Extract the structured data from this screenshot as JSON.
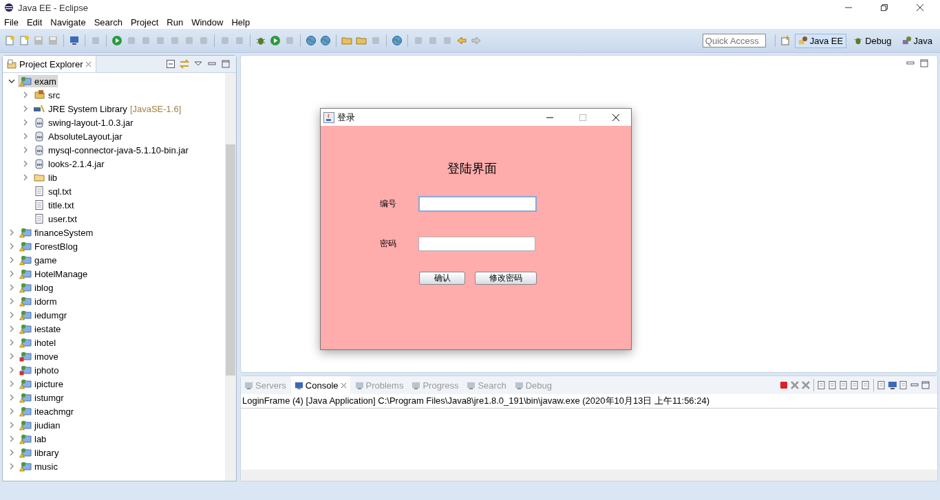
{
  "window": {
    "title": "Java EE - Eclipse"
  },
  "menu": [
    "File",
    "Edit",
    "Navigate",
    "Search",
    "Project",
    "Run",
    "Window",
    "Help"
  ],
  "toolbar": {
    "quick_access": {
      "placeholder": "Quick Access"
    },
    "perspectives": [
      {
        "label": "Java EE",
        "selected": true,
        "kind": "jee"
      },
      {
        "label": "Debug",
        "selected": false,
        "kind": "debug"
      },
      {
        "label": "Java",
        "selected": false,
        "kind": "java"
      }
    ]
  },
  "project_explorer": {
    "title": "Project Explorer",
    "tree": [
      {
        "label": "exam",
        "kind": "project",
        "error": false,
        "expanded": true,
        "selected": true,
        "children": [
          {
            "label": "src",
            "kind": "src",
            "expanded": false,
            "selected": false
          },
          {
            "label": "JRE System Library",
            "note": "[JavaSE-1.6]",
            "kind": "library",
            "expanded": false,
            "selected": false
          },
          {
            "label": "swing-layout-1.0.3.jar",
            "kind": "jar",
            "expanded": false,
            "selected": false
          },
          {
            "label": "AbsoluteLayout.jar",
            "kind": "jar",
            "expanded": false,
            "selected": false
          },
          {
            "label": "mysql-connector-java-5.1.10-bin.jar",
            "kind": "jar",
            "expanded": false,
            "selected": false
          },
          {
            "label": "looks-2.1.4.jar",
            "kind": "jar",
            "expanded": false,
            "selected": false
          },
          {
            "label": "lib",
            "kind": "folder",
            "expanded": false,
            "selected": false
          },
          {
            "label": "sql.txt",
            "kind": "file",
            "selected": false
          },
          {
            "label": "title.txt",
            "kind": "file",
            "selected": false
          },
          {
            "label": "user.txt",
            "kind": "file",
            "selected": false
          }
        ]
      },
      {
        "label": "financeSystem",
        "kind": "project",
        "error": false,
        "expanded": false,
        "selected": false
      },
      {
        "label": "ForestBlog",
        "kind": "project",
        "error": false,
        "expanded": false,
        "selected": false
      },
      {
        "label": "game",
        "kind": "project",
        "error": false,
        "expanded": false,
        "selected": false
      },
      {
        "label": "HotelManage",
        "kind": "project",
        "error": false,
        "expanded": false,
        "selected": false
      },
      {
        "label": "iblog",
        "kind": "project",
        "error": false,
        "expanded": false,
        "selected": false
      },
      {
        "label": "idorm",
        "kind": "project",
        "error": false,
        "expanded": false,
        "selected": false
      },
      {
        "label": "iedumgr",
        "kind": "project",
        "error": false,
        "expanded": false,
        "selected": false
      },
      {
        "label": "iestate",
        "kind": "project",
        "error": false,
        "expanded": false,
        "selected": false
      },
      {
        "label": "ihotel",
        "kind": "project",
        "error": false,
        "expanded": false,
        "selected": false
      },
      {
        "label": "imove",
        "kind": "project",
        "error": true,
        "expanded": false,
        "selected": false
      },
      {
        "label": "iphoto",
        "kind": "project",
        "error": true,
        "expanded": false,
        "selected": false
      },
      {
        "label": "ipicture",
        "kind": "project",
        "error": false,
        "expanded": false,
        "selected": false
      },
      {
        "label": "istumgr",
        "kind": "project",
        "error": false,
        "expanded": false,
        "selected": false
      },
      {
        "label": "iteachmgr",
        "kind": "project",
        "error": false,
        "expanded": false,
        "selected": false
      },
      {
        "label": "jiudian",
        "kind": "project",
        "error": false,
        "expanded": false,
        "selected": false
      },
      {
        "label": "lab",
        "kind": "project",
        "error": false,
        "expanded": false,
        "selected": false
      },
      {
        "label": "library",
        "kind": "project",
        "error": false,
        "expanded": false,
        "selected": false
      },
      {
        "label": "music",
        "kind": "project",
        "error": false,
        "expanded": false,
        "selected": false
      }
    ]
  },
  "dialog": {
    "title": "登录",
    "heading": "登陆界面",
    "fields": [
      {
        "label": "编号",
        "focused": true
      },
      {
        "label": "密码",
        "focused": false
      }
    ],
    "buttons": [
      "确认",
      "修改密码"
    ]
  },
  "bottom_panel": {
    "tabs": [
      {
        "label": "Servers",
        "selected": false
      },
      {
        "label": "Console",
        "selected": true
      },
      {
        "label": "Problems",
        "selected": false
      },
      {
        "label": "Progress",
        "selected": false
      },
      {
        "label": "Search",
        "selected": false
      },
      {
        "label": "Debug",
        "selected": false
      }
    ],
    "console_header": "LoginFrame (4) [Java Application] C:\\Program Files\\Java8\\jre1.8.0_191\\bin\\javaw.exe (2020年10月13日 上午11:56:24)"
  }
}
